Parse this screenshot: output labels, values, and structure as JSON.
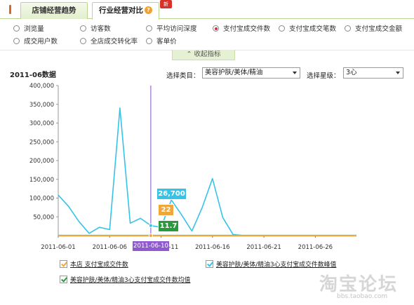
{
  "tabs": [
    {
      "label": "店铺经营趋势",
      "active": false
    },
    {
      "label": "行业经营对比",
      "active": true
    }
  ],
  "new_badge": "新",
  "metrics": [
    {
      "label": "浏览量",
      "checked": false
    },
    {
      "label": "访客数",
      "checked": false
    },
    {
      "label": "平均访问深度",
      "checked": false
    },
    {
      "label": "支付宝成交件数",
      "checked": true
    },
    {
      "label": "支付宝成交笔数",
      "checked": false
    },
    {
      "label": "支付宝成交金额",
      "checked": false
    },
    {
      "label": "成交用户数",
      "checked": false
    },
    {
      "label": "全店成交转化率",
      "checked": false
    },
    {
      "label": "客单价",
      "checked": false
    }
  ],
  "collapse_label": "⌃ 收起指标",
  "chart_title": "2011-06数据",
  "filters": {
    "category_label": "选择类目：",
    "category_value": "美容护肤/美体/精油",
    "star_label": "选择星级：",
    "star_value": "3心"
  },
  "tooltip": {
    "date": "2011-06-10",
    "peak_value": "26,700",
    "store_value": "22",
    "avg_value": "11.7"
  },
  "legend": [
    {
      "label": "本店 支付宝成交件数",
      "color": "#f0a63a"
    },
    {
      "label": "美容护肤/美体/精油3心支付宝成交件数峰值",
      "color": "#36c3e8"
    },
    {
      "label": "美容护肤/美体/精油3心支付宝成交件数均值",
      "color": "#2b9a3f"
    }
  ],
  "watermark": {
    "text": "淘宝论坛",
    "url": "bbs.taobao.com"
  },
  "chart_data": {
    "type": "line",
    "title": "2011-06数据",
    "x": [
      "2011-06-01",
      "2011-06-02",
      "2011-06-03",
      "2011-06-04",
      "2011-06-05",
      "2011-06-06",
      "2011-06-07",
      "2011-06-08",
      "2011-06-09",
      "2011-06-10",
      "2011-06-11",
      "2011-06-12",
      "2011-06-13",
      "2011-06-14",
      "2011-06-15",
      "2011-06-16",
      "2011-06-17",
      "2011-06-18",
      "2011-06-19",
      "2011-06-20",
      "2011-06-21",
      "2011-06-22",
      "2011-06-23",
      "2011-06-24",
      "2011-06-25",
      "2011-06-26",
      "2011-06-27",
      "2011-06-28",
      "2011-06-29",
      "2011-06-30"
    ],
    "xticks": [
      "2011-06-01",
      "2011-06-06",
      "2011-06-11",
      "2011-06-16",
      "2011-06-21",
      "2011-06-26"
    ],
    "ylim": [
      0,
      400000
    ],
    "yticks": [
      "50,000",
      "100,000",
      "150,000",
      "200,000",
      "250,000",
      "300,000",
      "350,000",
      "400,000"
    ],
    "series": [
      {
        "name": "美容护肤/美体/精油3心支付宝成交件数峰值",
        "color": "#36c3e8",
        "values": [
          108000,
          78000,
          38000,
          6000,
          22000,
          16000,
          340000,
          33000,
          46000,
          26700,
          22000,
          95000,
          55000,
          12000,
          75000,
          152000,
          48000,
          3000,
          0,
          0,
          0,
          0,
          0,
          0,
          0,
          0,
          0,
          0,
          0,
          0
        ]
      },
      {
        "name": "美容护肤/美体/精油3心支付宝成交件数均值",
        "color": "#2b9a3f",
        "values": [
          12,
          11,
          10,
          9,
          11,
          12,
          13,
          12,
          12,
          11.7,
          11,
          12,
          12,
          11,
          12,
          13,
          12,
          10,
          0,
          0,
          0,
          0,
          0,
          0,
          0,
          0,
          0,
          0,
          0,
          0
        ]
      },
      {
        "name": "本店 支付宝成交件数",
        "color": "#f0a63a",
        "values": [
          0,
          0,
          0,
          0,
          0,
          0,
          0,
          0,
          0,
          22,
          0,
          0,
          0,
          0,
          0,
          0,
          0,
          0,
          0,
          0,
          0,
          0,
          0,
          0,
          0,
          0,
          0,
          0,
          0,
          0
        ]
      }
    ]
  }
}
